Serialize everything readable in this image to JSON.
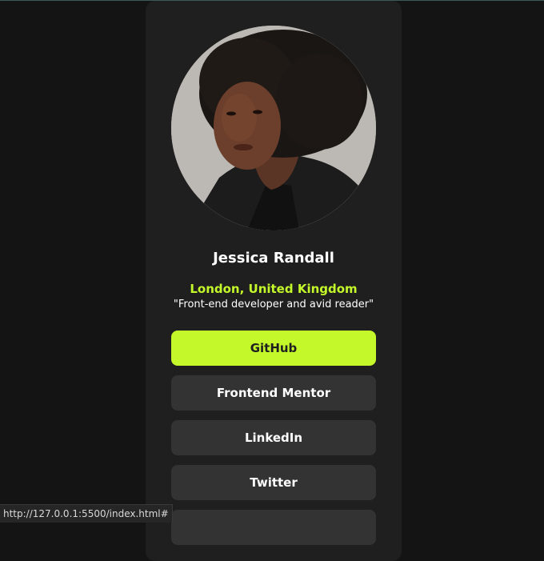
{
  "profile": {
    "name": "Jessica Randall",
    "location": "London, United Kingdom",
    "bio": "\"Front-end developer and avid reader\""
  },
  "links": [
    {
      "label": "GitHub",
      "active": true
    },
    {
      "label": "Frontend Mentor",
      "active": false
    },
    {
      "label": "LinkedIn",
      "active": false
    },
    {
      "label": "Twitter",
      "active": false
    },
    {
      "label": "",
      "active": false
    }
  ],
  "status_bar": {
    "url": "http://127.0.0.1:5500/index.html#"
  },
  "colors": {
    "page_bg": "#141414",
    "card_bg": "#1f1f1f",
    "accent": "#c4f82a",
    "button_bg": "#333333"
  }
}
